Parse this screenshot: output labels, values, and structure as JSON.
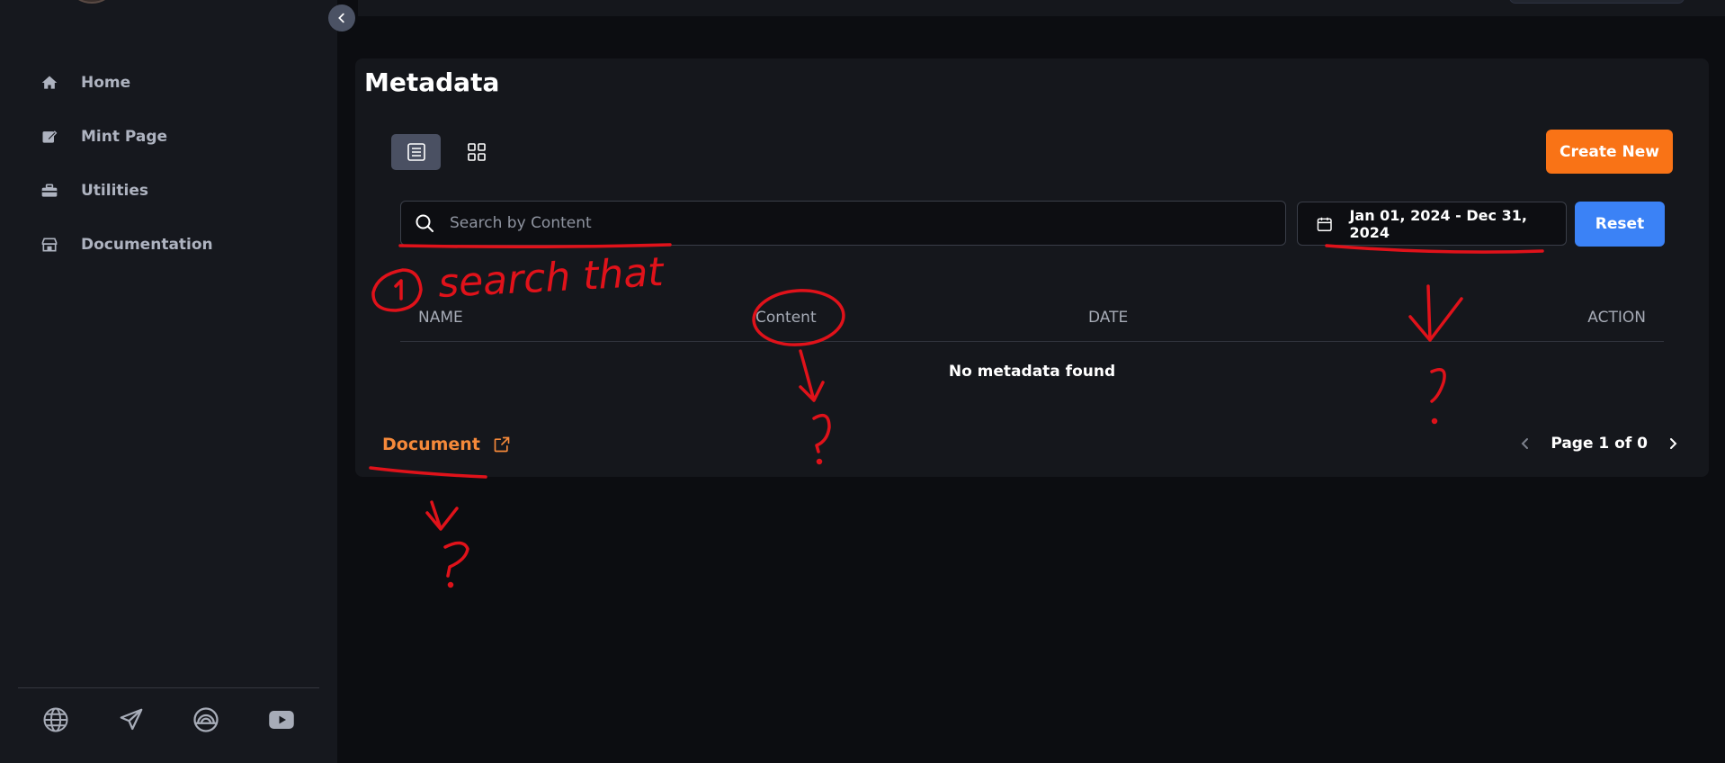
{
  "sidebar": {
    "items": [
      {
        "label": "Home",
        "icon": "home-icon"
      },
      {
        "label": "Mint Page",
        "icon": "edit-square-icon"
      },
      {
        "label": "Utilities",
        "icon": "toolbox-icon"
      },
      {
        "label": "Documentation",
        "icon": "store-icon"
      }
    ],
    "social": [
      "globe-icon",
      "send-icon",
      "rainbow-icon",
      "youtube-icon"
    ]
  },
  "main": {
    "title": "Metadata",
    "create_label": "Create New",
    "search": {
      "placeholder": "Search by Content",
      "value": ""
    },
    "date_range": "Jan 01, 2024 - Dec 31, 2024",
    "reset_label": "Reset",
    "table": {
      "headers": [
        "NAME",
        "Content",
        "DATE",
        "ACTION"
      ],
      "empty_message": "No metadata found"
    },
    "document_link": "Document",
    "pagination": "Page 1 of 0"
  },
  "annotations": {
    "search_note": "① search that",
    "question_mark": "?"
  },
  "colors": {
    "accent_orange": "#f97316",
    "primary_blue": "#3b82f6",
    "annotation_red": "#e0121a",
    "background": "#0c0d11",
    "sidebar": "#16181e"
  }
}
